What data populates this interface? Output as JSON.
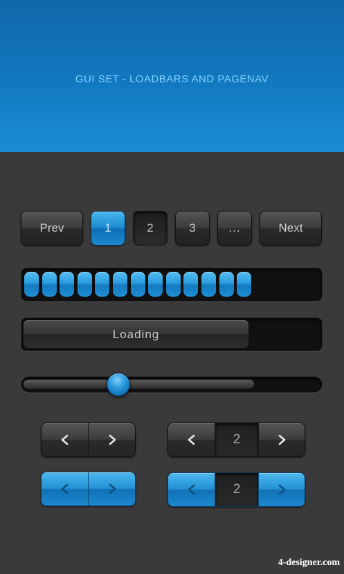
{
  "header": {
    "title": "GUI SET - LOADBARS AND PAGENAV"
  },
  "pagination": {
    "prev_label": "Prev",
    "pages": [
      "1",
      "2",
      "3",
      "..."
    ],
    "next_label": "Next",
    "active_page": "1",
    "pressed_page": "2"
  },
  "segmented_progress": {
    "filled_segments": 13
  },
  "loading_bar": {
    "label": "Loading",
    "progress": 0.76
  },
  "slider": {
    "value": 0.32,
    "track_fill": 0.78
  },
  "steppers": {
    "dark_value": "2",
    "blue_value": "2"
  },
  "icons": {
    "left": "chevron-left-icon",
    "right": "chevron-right-icon"
  },
  "colors": {
    "accent": "#1d8cd0",
    "header_text": "#7fd0ff",
    "background": "#3a3a3b"
  },
  "watermark": "4-designer.com"
}
